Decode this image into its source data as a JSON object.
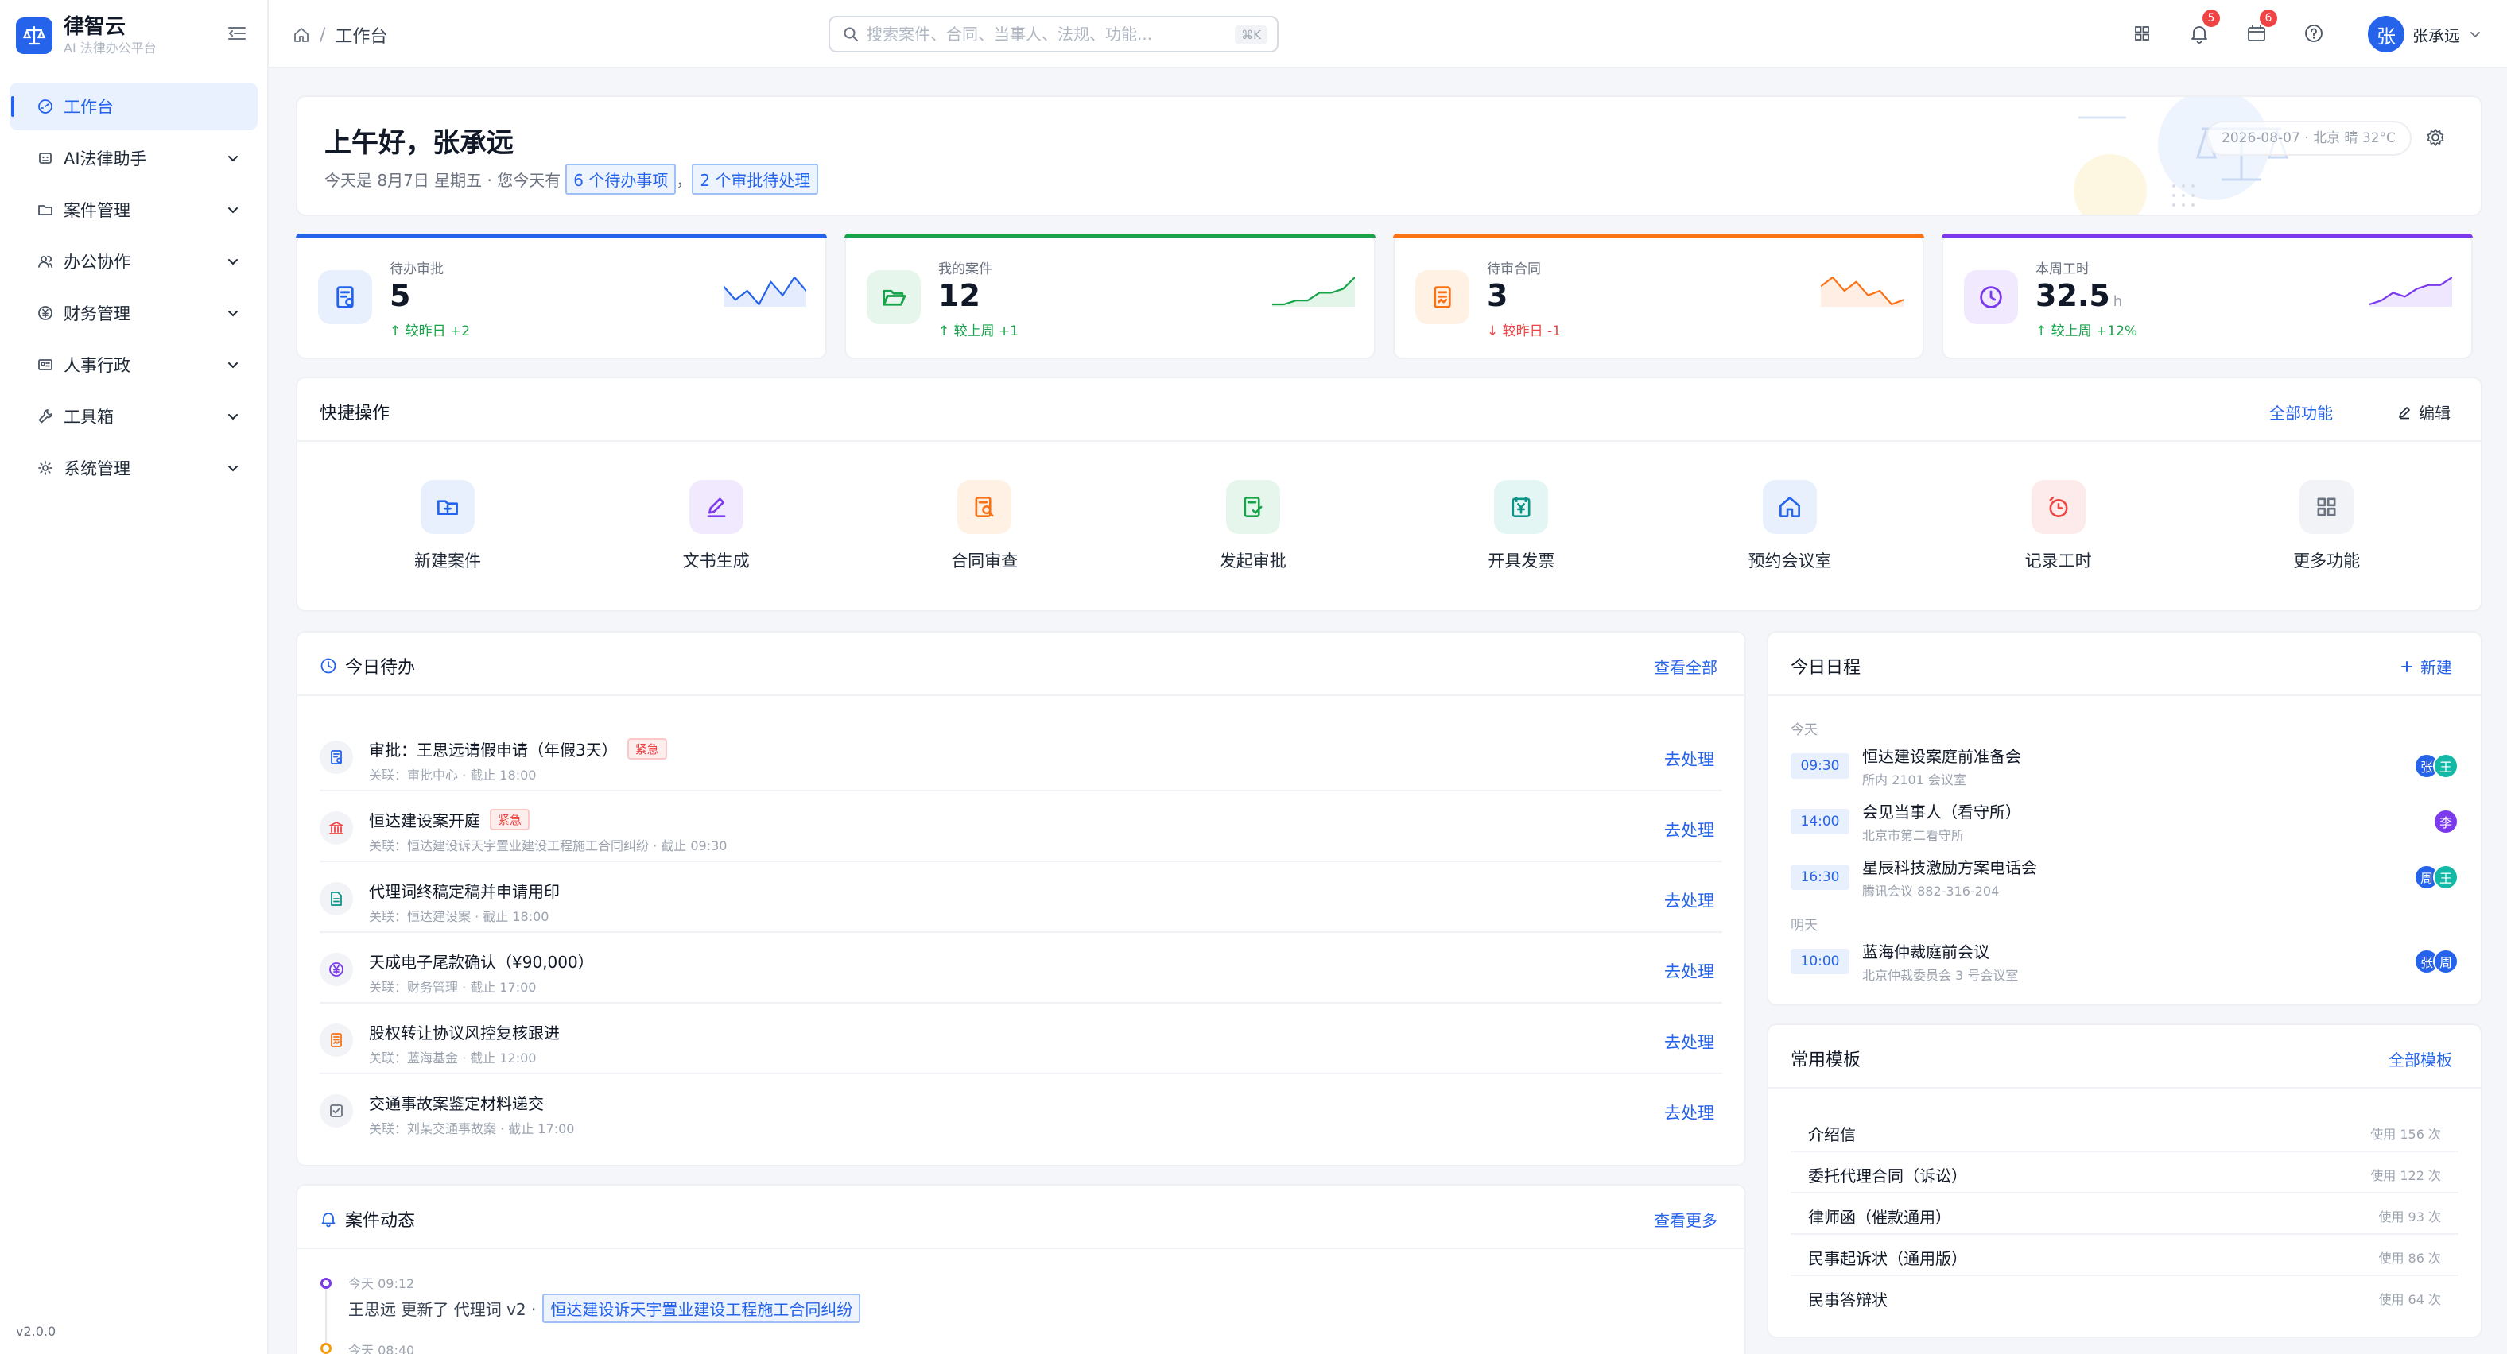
{
  "brand": {
    "name": "律智云",
    "subtitle": "AI 法律办公平台"
  },
  "sidebar": {
    "items": [
      {
        "label": "工作台",
        "icon": "dashboard-icon",
        "active": true
      },
      {
        "label": "AI法律助手",
        "icon": "robot-icon"
      },
      {
        "label": "案件管理",
        "icon": "folder-icon"
      },
      {
        "label": "办公协作",
        "icon": "team-icon"
      },
      {
        "label": "财务管理",
        "icon": "yen-icon"
      },
      {
        "label": "人事行政",
        "icon": "id-card-icon"
      },
      {
        "label": "工具箱",
        "icon": "wrench-icon"
      },
      {
        "label": "系统管理",
        "icon": "gear-icon"
      }
    ],
    "version": "v2.0.0"
  },
  "topbar": {
    "breadcrumb": {
      "current": "工作台",
      "separator": "/"
    },
    "search": {
      "placeholder": "搜索案件、合同、当事人、法规、功能...",
      "shortcut": "⌘K"
    },
    "notifications": {
      "bell_count": "5",
      "calendar_count": "6"
    },
    "user": {
      "avatar": "张",
      "name": "张承远"
    }
  },
  "greeting": {
    "title": "上午好，张承远",
    "prefix": "今天是 8月7日 星期五 · 您今天有",
    "todo_link": "6 个待办事项",
    "comma": "，",
    "approval_link": "2 个审批待处理",
    "meta": "2026-08-07 · 北京 晴 32°C"
  },
  "stats": [
    {
      "label": "待办审批",
      "value": "5",
      "unit": "",
      "delta": "较昨日 +2",
      "trend": "up",
      "color": "#2563eb",
      "icon": "approval-doc-icon",
      "spark": [
        7,
        4,
        6,
        3,
        8,
        5,
        9,
        6
      ]
    },
    {
      "label": "我的案件",
      "value": "12",
      "unit": "",
      "delta": "较上周 +1",
      "trend": "up",
      "color": "#16a34a",
      "icon": "folder-open-icon",
      "spark": [
        3,
        3,
        4,
        4,
        6,
        6,
        7,
        10
      ]
    },
    {
      "label": "待审合同",
      "value": "3",
      "unit": "",
      "delta": "较昨日 -1",
      "trend": "down",
      "color": "#f97316",
      "icon": "contract-icon",
      "spark": [
        7,
        9,
        6,
        8,
        5,
        6,
        3,
        4
      ]
    },
    {
      "label": "本周工时",
      "value": "32.5",
      "unit": "h",
      "delta": "较上周 +12%",
      "trend": "up",
      "color": "#7c3aed",
      "icon": "clock-icon",
      "spark": [
        2,
        3,
        5,
        4,
        6,
        7,
        7,
        9
      ]
    }
  ],
  "quick": {
    "title": "快捷操作",
    "all_link": "全部功能",
    "edit_link": "编辑",
    "items": [
      {
        "label": "新建案件",
        "icon": "new-case-icon",
        "color": "#2563eb",
        "bg": "#e8f0fd"
      },
      {
        "label": "文书生成",
        "icon": "pen-icon",
        "color": "#7c3aed",
        "bg": "#f1eafe"
      },
      {
        "label": "合同审查",
        "icon": "contract-search-icon",
        "color": "#f97316",
        "bg": "#fff1e4"
      },
      {
        "label": "发起审批",
        "icon": "approval-icon",
        "color": "#16a34a",
        "bg": "#e6f6ec"
      },
      {
        "label": "开具发票",
        "icon": "invoice-icon",
        "color": "#0d9488",
        "bg": "#e3f6f3"
      },
      {
        "label": "预约会议室",
        "icon": "home-icon",
        "color": "#2563eb",
        "bg": "#e8f0fd"
      },
      {
        "label": "记录工时",
        "icon": "timer-icon",
        "color": "#ef4444",
        "bg": "#fdeaea"
      },
      {
        "label": "更多功能",
        "icon": "grid-icon",
        "color": "#6b7280",
        "bg": "#f1f3f6"
      }
    ]
  },
  "todo": {
    "title": "今日待办",
    "all_link": "查看全部",
    "items": [
      {
        "title": "审批：王思远请假申请（年假3天）",
        "urgent": "紧急",
        "sub": "关联：审批中心 · 截止 18:00",
        "action": "去处理",
        "icon": "approval-doc-icon",
        "color": "#2563eb"
      },
      {
        "title": "恒达建设案开庭",
        "urgent": "紧急",
        "sub": "关联：恒达建设诉天宇置业建设工程施工合同纠纷 · 截止 09:30",
        "action": "去处理",
        "icon": "court-icon",
        "color": "#ef4444"
      },
      {
        "title": "代理词终稿定稿并申请用印",
        "urgent": "",
        "sub": "关联：恒达建设案 · 截止 18:00",
        "action": "去处理",
        "icon": "file-icon",
        "color": "#0d9488"
      },
      {
        "title": "天成电子尾款确认（¥90,000）",
        "urgent": "",
        "sub": "关联：财务管理 · 截止 17:00",
        "action": "去处理",
        "icon": "yen-icon",
        "color": "#7c3aed"
      },
      {
        "title": "股权转让协议风控复核跟进",
        "urgent": "",
        "sub": "关联：蓝海基金 · 截止 12:00",
        "action": "去处理",
        "icon": "contract-icon",
        "color": "#f97316"
      },
      {
        "title": "交通事故案鉴定材料递交",
        "urgent": "",
        "sub": "关联：刘某交通事故案 · 截止 17:00",
        "action": "去处理",
        "icon": "checkbox-icon",
        "color": "#6b7280"
      }
    ]
  },
  "schedule": {
    "title": "今日日程",
    "new_link": "新建",
    "today_label": "今天",
    "tomorrow_label": "明天",
    "items": [
      {
        "time": "09:30",
        "title": "恒达建设案庭前准备会",
        "sub": "所内 2101 会议室",
        "avatars": [
          {
            "t": "张",
            "c": "#2563eb"
          },
          {
            "t": "王",
            "c": "#14b8a6"
          }
        ]
      },
      {
        "time": "14:00",
        "title": "会见当事人（看守所）",
        "sub": "北京市第二看守所",
        "avatars": [
          {
            "t": "李",
            "c": "#7c3aed"
          }
        ]
      },
      {
        "time": "16:30",
        "title": "星辰科技激励方案电话会",
        "sub": "腾讯会议 882-316-204",
        "avatars": [
          {
            "t": "周",
            "c": "#2563eb"
          },
          {
            "t": "王",
            "c": "#14b8a6"
          }
        ]
      },
      {
        "time": "10:00",
        "title": "蓝海仲裁庭前会议",
        "sub": "北京仲裁委员会 3 号会议室",
        "avatars": [
          {
            "t": "张",
            "c": "#2563eb"
          },
          {
            "t": "周",
            "c": "#2563eb"
          }
        ]
      }
    ]
  },
  "templates": {
    "title": "常用模板",
    "all_link": "全部模板",
    "items": [
      {
        "name": "介绍信",
        "count": "使用 156 次"
      },
      {
        "name": "委托代理合同（诉讼）",
        "count": "使用 122 次"
      },
      {
        "name": "律师函（催款通用）",
        "count": "使用 93 次"
      },
      {
        "name": "民事起诉状（通用版）",
        "count": "使用 86 次"
      },
      {
        "name": "民事答辩状",
        "count": "使用 64 次"
      }
    ]
  },
  "feed": {
    "title": "案件动态",
    "more_link": "查看更多",
    "items": [
      {
        "time": "今天 09:12",
        "text": "王思远 更新了 代理词 v2 ·",
        "link": "恒达建设诉天宇置业建设工程施工合同纠纷"
      },
      {
        "time": "今天 08:40",
        "text": "",
        "link": ""
      }
    ]
  }
}
